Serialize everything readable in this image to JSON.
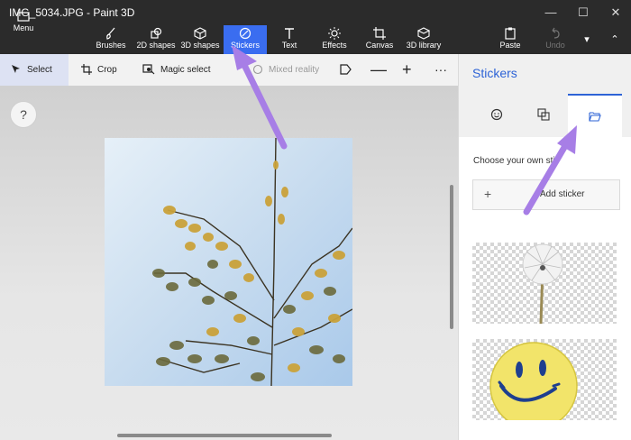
{
  "window": {
    "title": "IMG_5034.JPG - Paint 3D"
  },
  "ribbon": {
    "menu": "Menu",
    "tools": [
      "Brushes",
      "2D shapes",
      "3D shapes",
      "Stickers",
      "Text",
      "Effects",
      "Canvas",
      "3D library"
    ],
    "active_tool": "Stickers",
    "paste": "Paste",
    "undo": "Undo"
  },
  "toolbar": {
    "select": "Select",
    "crop": "Crop",
    "magic_select": "Magic select",
    "mixed_reality": "Mixed reality"
  },
  "canvas": {
    "help": "?"
  },
  "panel": {
    "title": "Stickers",
    "choose_text": "Choose your own sticker",
    "add_sticker": "Add sticker",
    "plus": "+",
    "stickers": [
      "dandelion",
      "smiley face"
    ]
  },
  "colors": {
    "accent": "#3a6df0",
    "arrow": "#a77ee6",
    "titlebar": "#2b2b2b",
    "panel_title": "#2d63d6"
  }
}
